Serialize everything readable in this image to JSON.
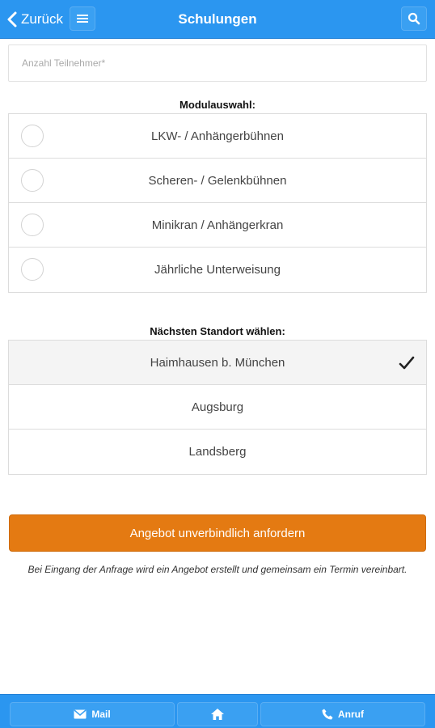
{
  "header": {
    "back_label": "Zurück",
    "title": "Schulungen",
    "menu_icon": "menu-icon",
    "search_icon": "search-icon",
    "color": "#2b96f0"
  },
  "form": {
    "participants_placeholder": "Anzahl Teilnehmer*",
    "participants_value": ""
  },
  "modules": {
    "label": "Modulauswahl:",
    "items": [
      {
        "label": "LKW- / Anhängerbühnen",
        "selected": false
      },
      {
        "label": "Scheren- / Gelenkbühnen",
        "selected": false
      },
      {
        "label": "Minikran / Anhängerkran",
        "selected": false
      },
      {
        "label": "Jährliche Unterweisung",
        "selected": false
      }
    ]
  },
  "locations": {
    "label": "Nächsten Standort wählen:",
    "items": [
      {
        "label": "Haimhausen b. München",
        "selected": true
      },
      {
        "label": "Augsburg",
        "selected": false
      },
      {
        "label": "Landsberg",
        "selected": false
      }
    ]
  },
  "cta": {
    "label": "Angebot unverbindlich anfordern",
    "color": "#e47a12"
  },
  "note": "Bei Eingang der Anfrage wird ein Angebot erstellt und gemeinsam ein Termin vereinbart.",
  "footer": {
    "mail_label": "Mail",
    "call_label": "Anruf",
    "home_icon": "home-icon"
  }
}
